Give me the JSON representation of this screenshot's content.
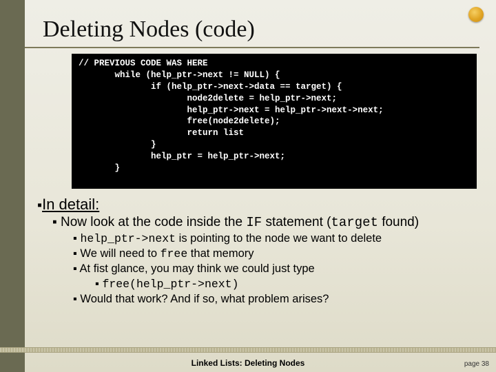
{
  "title": "Deleting Nodes (code)",
  "code": {
    "l0": "// PREVIOUS CODE WAS HERE",
    "l1": "       while (help_ptr->next != NULL) {",
    "l2": "              if (help_ptr->next->data == target) {",
    "l3": "                     node2delete = help_ptr->next;",
    "l4": "                     help_ptr->next = help_ptr->next->next;",
    "l5": "                     free(node2delete);",
    "l6": "                     return list",
    "l7": "              }",
    "l8": "              help_ptr = help_ptr->next;",
    "l9": "       }"
  },
  "detail": {
    "heading_prefix": "▪",
    "heading": "In detail:",
    "b1_prefix": "▪ Now look at the code inside the ",
    "b1_code1": "IF",
    "b1_mid": " statement (",
    "b1_code2": "target",
    "b1_suffix": " found)",
    "b2a_prefix": "▪ ",
    "b2a_code": "help_ptr->next",
    "b2a_suffix": " is pointing to the node we want to delete",
    "b2b_prefix": "▪ We will need to ",
    "b2b_code": "free",
    "b2b_suffix": " that memory",
    "b2c": "▪ At fist glance, you may think we could just type",
    "b3_prefix": "▪ ",
    "b3_code": "free(help_ptr->next)",
    "b2d": "▪ Would that work?  And if so, what problem arises?"
  },
  "footer": {
    "title": "Linked Lists:  Deleting Nodes",
    "page": "page 38"
  }
}
